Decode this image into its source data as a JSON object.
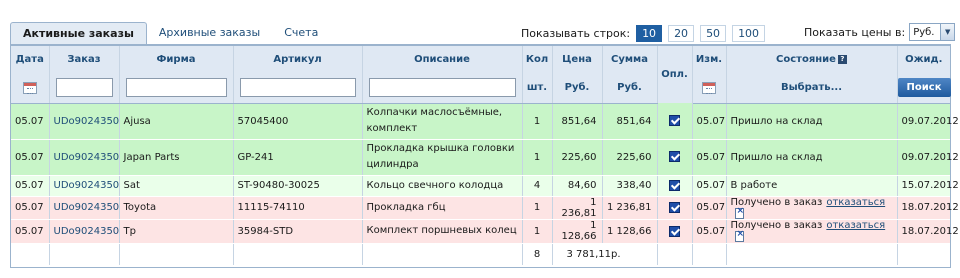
{
  "tabs": [
    {
      "label": "Активные заказы",
      "active": true
    },
    {
      "label": "Архивные заказы",
      "active": false
    },
    {
      "label": "Счета",
      "active": false
    }
  ],
  "rows_per_page": {
    "label": "Показывать строк:",
    "options": [
      "10",
      "20",
      "50",
      "100"
    ],
    "selected": "10"
  },
  "price_currency": {
    "label": "Показать цены в:",
    "selected": "Руб."
  },
  "columns": {
    "date": "Дата",
    "order": "Заказ",
    "firm": "Фирма",
    "article": "Артикул",
    "description": "Описание",
    "qty_top": "Кол",
    "qty_bottom": "шт.",
    "price_top": "Цена",
    "price_bottom": "Руб.",
    "sum_top": "Сумма",
    "sum_bottom": "Руб.",
    "paid": "Опл.",
    "changed": "Изм.",
    "status": "Состояние",
    "status_choose": "Выбрать...",
    "expected": "Ожид.",
    "search_button": "Поиск"
  },
  "rows": [
    {
      "date": "05.07",
      "order": "UDo9024350",
      "firm": "Ajusa",
      "article": "57045400",
      "description": "Колпачки маслосъёмные, комплект",
      "qty": "1",
      "price": "851,64",
      "sum": "851,64",
      "paid": true,
      "changed": "05.07",
      "status": "Пришло на склад",
      "cancel": "",
      "expected": "09.07.2012",
      "color": "green"
    },
    {
      "date": "05.07",
      "order": "UDo9024350",
      "firm": "Japan Parts",
      "article": "GP-241",
      "description": "Прокладка крышка головки цилиндра",
      "qty": "1",
      "price": "225,60",
      "sum": "225,60",
      "paid": true,
      "changed": "05.07",
      "status": "Пришло на склад",
      "cancel": "",
      "expected": "09.07.2012",
      "color": "green"
    },
    {
      "date": "05.07",
      "order": "UDo9024350",
      "firm": "Sat",
      "article": "ST-90480-30025",
      "description": "Кольцо свечного колодца",
      "qty": "4",
      "price": "84,60",
      "sum": "338,40",
      "paid": true,
      "changed": "05.07",
      "status": "В работе",
      "cancel": "",
      "expected": "15.07.2012",
      "color": "lgreen"
    },
    {
      "date": "05.07",
      "order": "UDo9024350",
      "firm": "Toyota",
      "article": "11115-74110",
      "description": "Прокладка гбц",
      "qty": "1",
      "price": "1 236,81",
      "sum": "1 236,81",
      "paid": true,
      "changed": "05.07",
      "status": "Получено в заказ",
      "cancel": "отказаться",
      "expected": "18.07.2012",
      "color": "pink"
    },
    {
      "date": "05.07",
      "order": "UDo9024350",
      "firm": "Tp",
      "article": "35984-STD",
      "description": "Комплект поршневых колец",
      "qty": "1",
      "price": "1 128,66",
      "sum": "1 128,66",
      "paid": true,
      "changed": "05.07",
      "status": "Получено в заказ",
      "cancel": "отказаться",
      "expected": "18.07.2012",
      "color": "pink"
    }
  ],
  "totals": {
    "qty": "8",
    "sum": "3 781,11р."
  },
  "colors": {
    "green_row": "#c8f5c8",
    "light_green_row": "#eaffea",
    "pink_row": "#fde4e4",
    "header_bg": "#dfe8f3",
    "accent": "#1f5fa2"
  }
}
